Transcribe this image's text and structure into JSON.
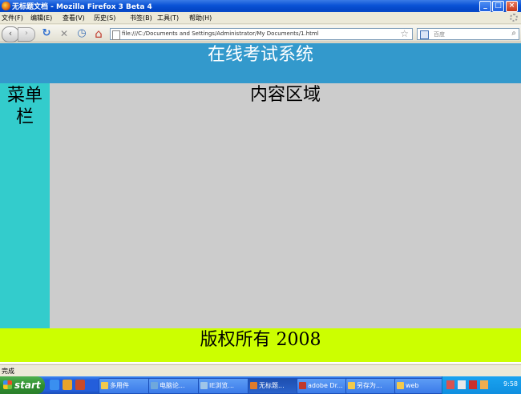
{
  "window": {
    "title": "无标题文档 - Mozilla Firefox 3 Beta 4",
    "min": "_",
    "max": "□",
    "close": "×"
  },
  "menu": [
    "文件(F)",
    "编辑(E)",
    "查看(V)",
    "历史(S)",
    "书签(B)",
    "工具(T)",
    "帮助(H)"
  ],
  "nav": {
    "back": "‹",
    "forward": "›",
    "reload": "↻",
    "stop": "✕",
    "history": "◷",
    "home": "⌂",
    "url": "file:///C:/Documents and Settings/Administrator/My Documents/1.html",
    "bookmark_star": "☆",
    "search_placeholder": "百度",
    "search_icon": "⌕"
  },
  "page": {
    "header": "在线考试系统",
    "sidebar": "菜单栏",
    "content": "内容区域",
    "footer": "版权所有 2008"
  },
  "status": "完成",
  "taskbar": {
    "start": "start",
    "tasks": [
      "多用件",
      "电脑论...",
      "IE浏览...",
      "无标题...",
      "adobe Dr...",
      "另存为...",
      "web"
    ],
    "clock": "9:58"
  },
  "colors": {
    "header_bg": "#3399cc",
    "sidebar_bg": "#33cccc",
    "content_bg": "#cccccc",
    "footer_bg": "#ccff00"
  }
}
